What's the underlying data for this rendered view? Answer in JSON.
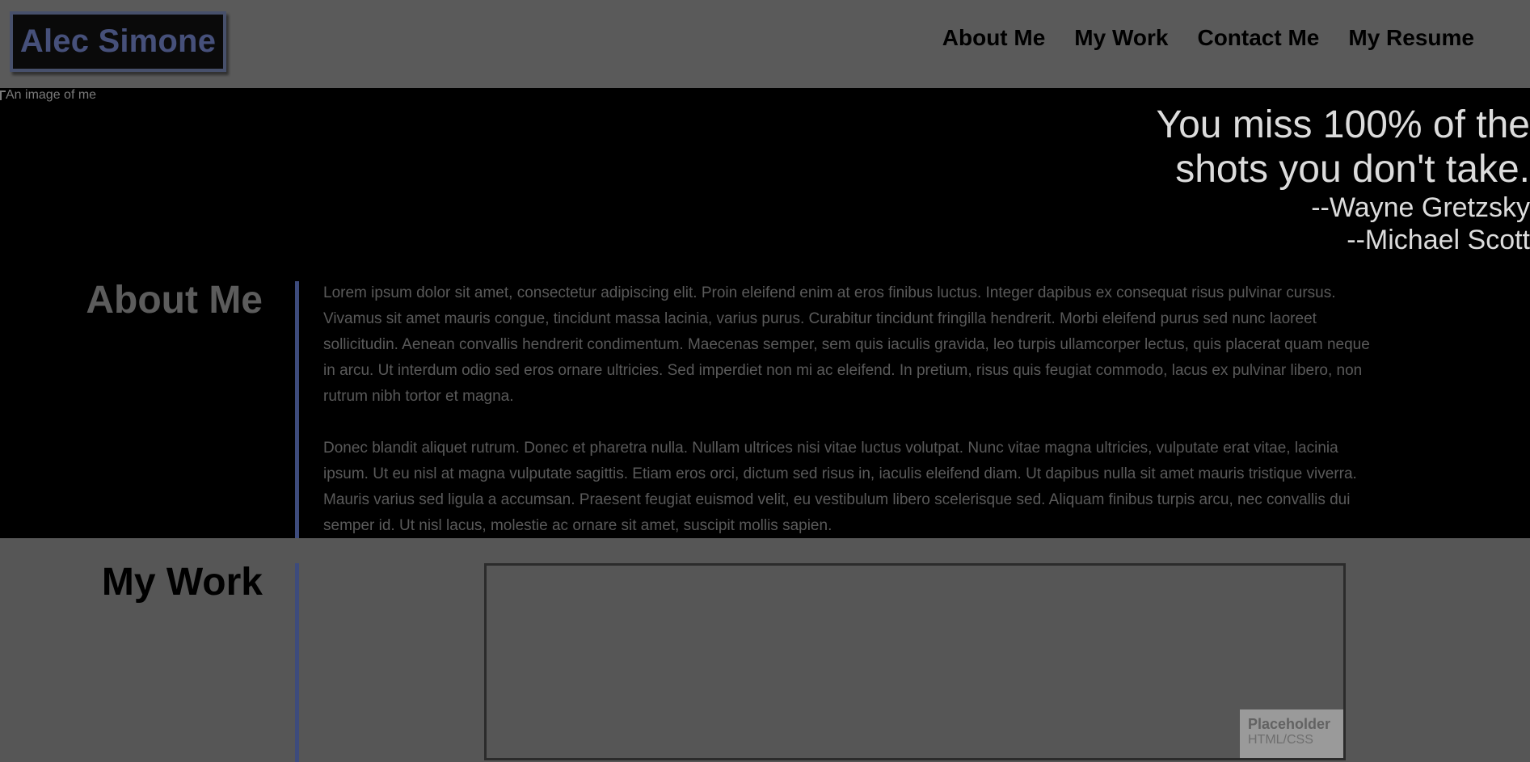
{
  "header": {
    "logo": "Alec Simone",
    "nav": [
      {
        "label": "About Me"
      },
      {
        "label": "My Work"
      },
      {
        "label": "Contact Me"
      },
      {
        "label": "My Resume"
      }
    ]
  },
  "hero": {
    "image_alt": "An image of me",
    "quote_lines": [
      "You miss 100% of the",
      "shots you don't take."
    ],
    "attributions": [
      "--Wayne Gretzsky",
      "--Michael Scott"
    ]
  },
  "about": {
    "title": "About Me",
    "paragraphs": [
      "Lorem ipsum dolor sit amet, consectetur adipiscing elit. Proin eleifend enim at eros finibus luctus. Integer dapibus ex consequat risus pulvinar cursus. Vivamus sit amet mauris congue, tincidunt massa lacinia, varius purus. Curabitur tincidunt fringilla hendrerit. Morbi eleifend purus sed nunc laoreet sollicitudin. Aenean convallis hendrerit condimentum. Maecenas semper, sem quis iaculis gravida, leo turpis ullamcorper lectus, quis placerat quam neque in arcu. Ut interdum odio sed eros ornare ultricies. Sed imperdiet non mi ac eleifend. In pretium, risus quis feugiat commodo, lacus ex pulvinar libero, non rutrum nibh tortor et magna.",
      "Donec blandit aliquet rutrum. Donec et pharetra nulla. Nullam ultrices nisi vitae luctus volutpat. Nunc vitae magna ultricies, vulputate erat vitae, lacinia ipsum. Ut eu nisl at magna vulputate sagittis. Etiam eros orci, dictum sed risus in, iaculis eleifend diam. Ut dapibus nulla sit amet mauris tristique viverra. Mauris varius sed ligula a accumsan. Praesent feugiat euismod velit, eu vestibulum libero scelerisque sed. Aliquam finibus turpis arcu, nec convallis dui semper id. Ut nisl lacus, molestie ac ornare sit amet, suscipit mollis sapien."
    ]
  },
  "work": {
    "title": "My Work",
    "placeholder_title": "Placeholder",
    "placeholder_sub": "HTML/CSS"
  },
  "colors": {
    "page_bg": "#565656",
    "hero_bg": "#000000",
    "accent": "#3d4b7c",
    "logo_text": "#46507a"
  }
}
